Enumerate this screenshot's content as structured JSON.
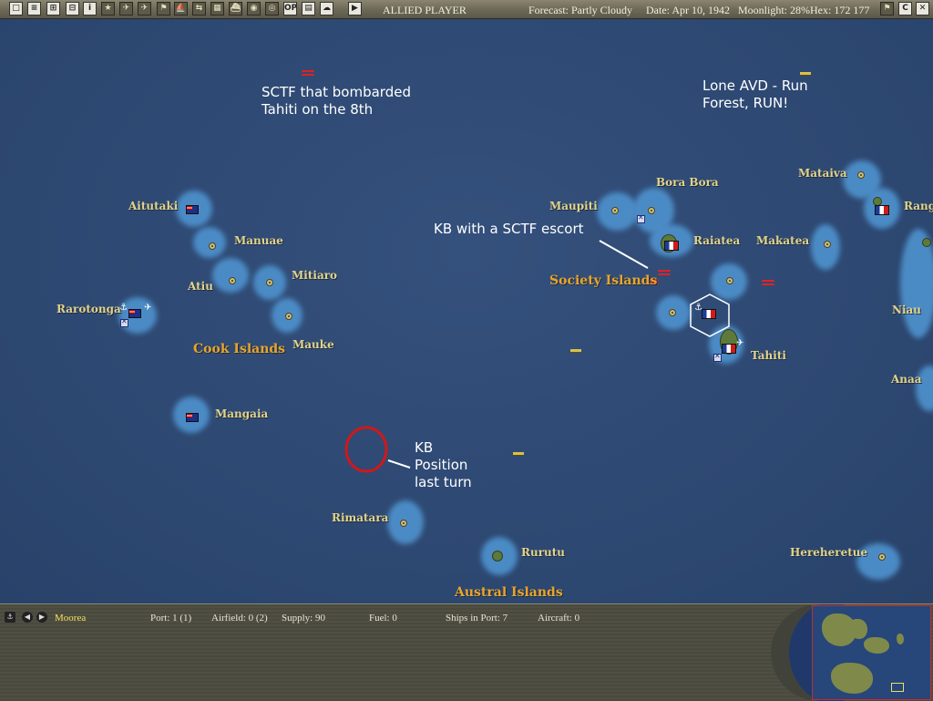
{
  "topbar": {
    "buttons": [
      "□",
      "≡",
      "⊞",
      "⊟",
      "i",
      "★",
      "✈",
      "✈",
      "⚑",
      "⛵",
      "⇆",
      "▦",
      "⛴",
      "◉",
      "◎",
      "OP",
      "▤",
      "☁",
      "▶"
    ],
    "player": "ALLIED PLAYER",
    "forecast": "Forecast: Partly Cloudy",
    "date": "Date: Apr 10, 1942",
    "moonlight": "Moonlight: 28%",
    "hex": "Hex: 172 177",
    "right_buttons": [
      "⚑",
      "C",
      "✕"
    ]
  },
  "map": {
    "places": {
      "aitutaki": "Aitutaki",
      "manuae": "Manuae",
      "atiu": "Atiu",
      "mitiaro": "Mitiaro",
      "rarotonga": "Rarotonga",
      "mauke": "Mauke",
      "mangaia": "Mangaia",
      "rimatara": "Rimatara",
      "rurutu": "Rurutu",
      "maupiti": "Maupiti",
      "bora_bora": "Bora Bora",
      "raiatea": "Raiatea",
      "makatea": "Makatea",
      "tahiti": "Tahiti",
      "mataiva": "Mataiva",
      "rang": "Rang",
      "niau": "Niau",
      "anaa": "Anaa",
      "hereheretue": "Hereheretue"
    },
    "regions": {
      "cook": "Cook Islands",
      "society": "Society Islands",
      "austral": "Austral Islands"
    },
    "annotations": {
      "sctf": "SCTF that bombarded Tahiti on the 8th",
      "avd": "Lone AVD - Run Forest, RUN!",
      "kb_escort": "KB with a SCTF escort",
      "kb_position": "KB Position last turn"
    }
  },
  "bottombar": {
    "base_name": "Moorea",
    "port": "Port: 1 (1)",
    "airfield": "Airfield: 0 (2)",
    "supply": "Supply: 90",
    "fuel": "Fuel: 0",
    "ships_in_port": "Ships in Port: 7",
    "aircraft": "Aircraft: 0"
  },
  "colors": {
    "ocean": "#2f4a74",
    "shoal": "#4d8fca",
    "place_label": "#e2d38a",
    "region_label": "#e9a52a",
    "enemy_ship": "#e02222",
    "kb_circle": "#d01818"
  }
}
